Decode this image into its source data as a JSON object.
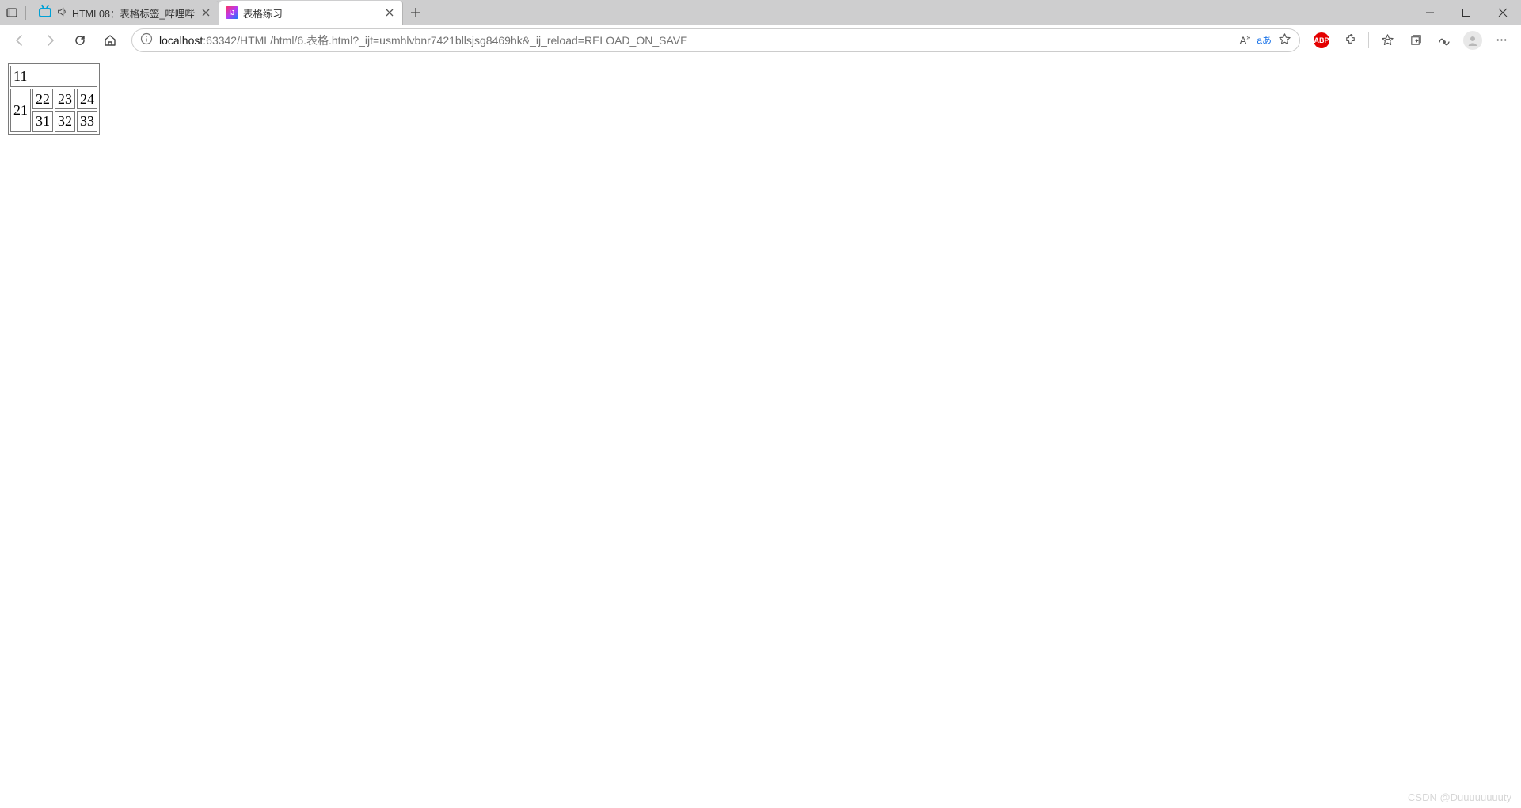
{
  "titlebar": {
    "tabs": [
      {
        "label": "HTML08：表格标签_哔哩哔",
        "active": false
      },
      {
        "label": "表格练习",
        "active": true
      }
    ]
  },
  "addressbar": {
    "host": "localhost",
    "rest": ":63342/HTML/html/6.表格.html?_ijt=usmhlvbnr7421bllsjsg8469hk&_ij_reload=RELOAD_ON_SAVE"
  },
  "toolbarRight": {
    "readAloud": "Aあ",
    "translate": "aあ",
    "abp": "ABP"
  },
  "table": {
    "r1": {
      "c11": "11"
    },
    "r2": {
      "c21": "21",
      "c22": "22",
      "c23": "23",
      "c24": "24"
    },
    "r3": {
      "c31": "31",
      "c32": "32",
      "c33": "33"
    }
  },
  "watermark": "CSDN @Duuuuuuuuty"
}
